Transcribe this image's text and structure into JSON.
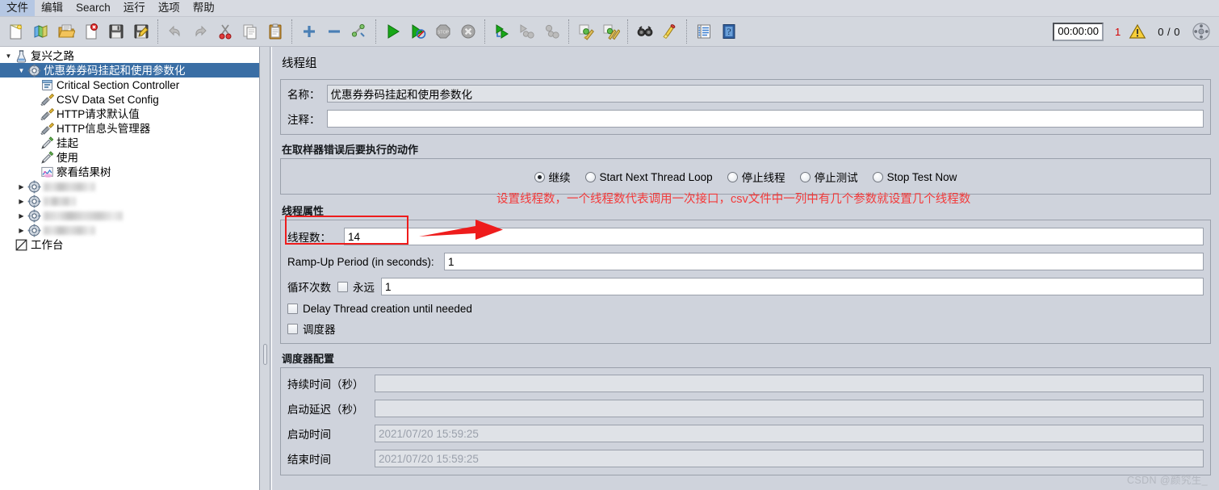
{
  "menu": {
    "items": [
      {
        "label": "文件",
        "name": "menu-file"
      },
      {
        "label": "编辑",
        "name": "menu-edit"
      },
      {
        "label": "Search",
        "name": "menu-search"
      },
      {
        "label": "运行",
        "name": "menu-run"
      },
      {
        "label": "选项",
        "name": "menu-options"
      },
      {
        "label": "帮助",
        "name": "menu-help"
      }
    ]
  },
  "toolbar": {
    "icons": [
      "new-icon",
      "templates-icon",
      "open-icon",
      "close-icon",
      "save-icon",
      "save-as-icon",
      "undo-icon",
      "redo-icon",
      "cut-icon",
      "copy-icon",
      "paste-icon",
      "expand-icon",
      "collapse-icon",
      "toggle-icon",
      "start-icon",
      "start-no-pauses-icon",
      "stop-icon",
      "shutdown-icon",
      "start-remote-icon",
      "stop-remote-icon",
      "shutdown-remote-icon",
      "clear-icon",
      "clear-all-icon",
      "search-icon",
      "reset-search-icon",
      "function-helper-icon",
      "help-icon"
    ],
    "timer": "00:00:00",
    "error_count": "1",
    "warning_icon": "warning-triangle-icon",
    "thread_ratio": "0 / 0",
    "reset_icon": "reset-gear-icon"
  },
  "tree": {
    "nodes": [
      {
        "label": "复兴之路",
        "icon": "test-plan-icon",
        "depth": 0,
        "twist": "▼",
        "selected": false,
        "blurred": false
      },
      {
        "label": "优惠券券码挂起和使用参数化",
        "icon": "thread-group-icon",
        "depth": 1,
        "twist": "▼",
        "selected": true,
        "blurred": false
      },
      {
        "label": "Critical Section Controller",
        "icon": "controller-icon",
        "depth": 2,
        "twist": "",
        "selected": false,
        "blurred": false
      },
      {
        "label": "CSV Data Set Config",
        "icon": "config-icon",
        "depth": 2,
        "twist": "",
        "selected": false,
        "blurred": false
      },
      {
        "label": "HTTP请求默认值",
        "icon": "config-icon",
        "depth": 2,
        "twist": "",
        "selected": false,
        "blurred": false
      },
      {
        "label": "HTTP信息头管理器",
        "icon": "config-icon",
        "depth": 2,
        "twist": "",
        "selected": false,
        "blurred": false
      },
      {
        "label": "挂起",
        "icon": "sampler-icon",
        "depth": 2,
        "twist": "",
        "selected": false,
        "blurred": false
      },
      {
        "label": "使用",
        "icon": "sampler-icon",
        "depth": 2,
        "twist": "",
        "selected": false,
        "blurred": false
      },
      {
        "label": "察看结果树",
        "icon": "listener-icon",
        "depth": 2,
        "twist": "",
        "selected": false,
        "blurred": false
      },
      {
        "label": "",
        "icon": "thread-group-icon",
        "depth": 1,
        "twist": "▶",
        "selected": false,
        "blurred": true,
        "blur_width": 64
      },
      {
        "label": "",
        "icon": "thread-group-icon",
        "depth": 1,
        "twist": "▶",
        "selected": false,
        "blurred": true,
        "blur_width": 40
      },
      {
        "label": "",
        "icon": "thread-group-icon",
        "depth": 1,
        "twist": "▶",
        "selected": false,
        "blurred": true,
        "blur_width": 98
      },
      {
        "label": "",
        "icon": "thread-group-icon",
        "depth": 1,
        "twist": "▶",
        "selected": false,
        "blurred": true,
        "blur_width": 64
      },
      {
        "label": "工作台",
        "icon": "workbench-icon",
        "depth": 0,
        "twist": "",
        "selected": false,
        "blurred": false
      }
    ]
  },
  "panel": {
    "title": "线程组",
    "name_label": "名称：",
    "name_value": "优惠券券码挂起和使用参数化",
    "comment_label": "注释：",
    "comment_value": "",
    "error_action": {
      "title": "在取样器错误后要执行的动作",
      "options": [
        {
          "label": "继续",
          "checked": true
        },
        {
          "label": "Start Next Thread Loop",
          "checked": false
        },
        {
          "label": "停止线程",
          "checked": false
        },
        {
          "label": "停止测试",
          "checked": false
        },
        {
          "label": "Stop Test Now",
          "checked": false
        }
      ]
    },
    "thread_props": {
      "title": "线程属性",
      "threads_label": "线程数：",
      "threads_value": "14",
      "rampup_label": "Ramp-Up Period (in seconds):",
      "rampup_value": "1",
      "loop_label": "循环次数",
      "forever_label": "永远",
      "forever_checked": false,
      "loop_value": "1",
      "delay_label": "Delay Thread creation until needed",
      "delay_checked": false,
      "scheduler_label": "调度器",
      "scheduler_checked": false
    },
    "scheduler": {
      "title": "调度器配置",
      "duration_label": "持续时间（秒）",
      "duration_value": "",
      "startup_delay_label": "启动延迟（秒）",
      "startup_delay_value": "",
      "start_time_label": "启动时间",
      "start_time_value": "2021/07/20 15:59:25",
      "end_time_label": "结束时间",
      "end_time_value": "2021/07/20 15:59:25"
    }
  },
  "annotation": {
    "text": "设置线程数，一个线程数代表调用一次接口，csv文件中一列中有几个参数就设置几个线程数",
    "color": "#f33a3a",
    "arrow": "red-arrow-right"
  },
  "watermark": "CSDN @颜究生_"
}
